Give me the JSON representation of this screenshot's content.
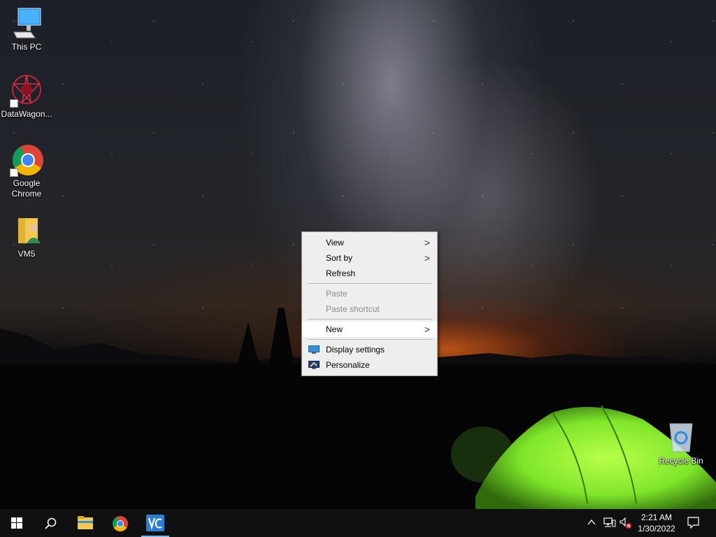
{
  "desktop": {
    "icons": [
      {
        "label": "This PC"
      },
      {
        "label": "DataWagon..."
      },
      {
        "label": "Google Chrome"
      },
      {
        "label": "VM5"
      },
      {
        "label": "Recycle Bin"
      }
    ]
  },
  "context_menu": {
    "items": [
      {
        "label": "View",
        "submenu": true
      },
      {
        "label": "Sort by",
        "submenu": true
      },
      {
        "label": "Refresh"
      },
      {
        "label": "Paste",
        "disabled": true
      },
      {
        "label": "Paste shortcut",
        "disabled": true
      },
      {
        "label": "New",
        "submenu": true,
        "highlighted": true
      },
      {
        "label": "Display settings",
        "icon": "display-icon"
      },
      {
        "label": "Personalize",
        "icon": "personalize-icon"
      }
    ],
    "chevron": ">"
  },
  "taskbar": {
    "buttons": [
      "start-icon",
      "search-icon",
      "file-explorer-icon",
      "chrome-icon",
      "vmware-icon"
    ],
    "active": "vmware-icon",
    "clock": {
      "time": "2:21 AM",
      "date": "1/30/2022"
    },
    "tray": [
      "chevron-up-icon",
      "network-icon",
      "volume-muted-icon",
      "notifications-icon"
    ]
  },
  "colors": {
    "taskbar": "#101010",
    "menu_bg": "#eeeeee",
    "menu_highlight": "#ffffff",
    "active_indicator": "#76b9ed",
    "tent": "#7fe62a"
  }
}
